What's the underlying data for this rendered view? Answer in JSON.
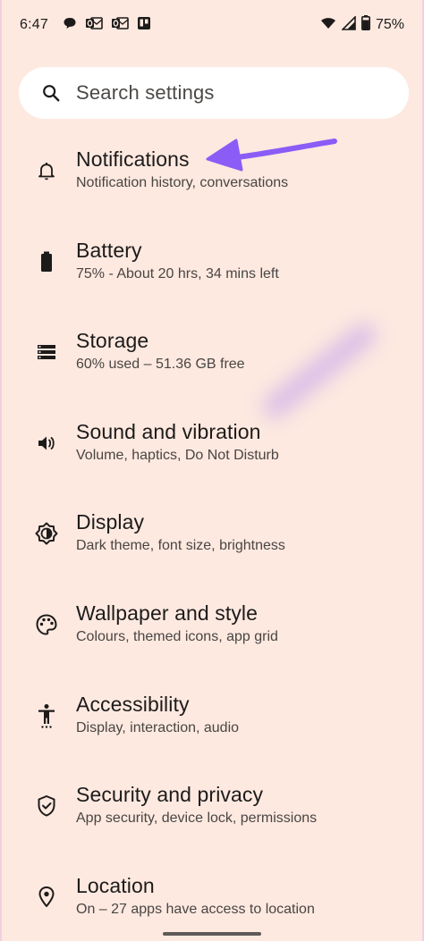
{
  "status_bar": {
    "time": "6:47",
    "battery_percent": "75%",
    "icons_left": [
      "chat-bubble-icon",
      "outlook-icon",
      "outlook-icon",
      "trello-icon"
    ],
    "icons_right": [
      "wifi-icon",
      "cellular-signal-icon",
      "battery-icon"
    ]
  },
  "search": {
    "placeholder": "Search settings"
  },
  "settings": [
    {
      "title": "Notifications",
      "subtitle": "Notification history, conversations",
      "icon": "bell-icon"
    },
    {
      "title": "Battery",
      "subtitle": "75% - About 20 hrs, 34 mins left",
      "icon": "battery-icon"
    },
    {
      "title": "Storage",
      "subtitle": "60% used – 51.36 GB free",
      "icon": "storage-icon"
    },
    {
      "title": "Sound and vibration",
      "subtitle": "Volume, haptics, Do Not Disturb",
      "icon": "volume-icon"
    },
    {
      "title": "Display",
      "subtitle": "Dark theme, font size, brightness",
      "icon": "brightness-icon"
    },
    {
      "title": "Wallpaper and style",
      "subtitle": "Colours, themed icons, app grid",
      "icon": "palette-icon"
    },
    {
      "title": "Accessibility",
      "subtitle": "Display, interaction, audio",
      "icon": "accessibility-icon"
    },
    {
      "title": "Security and privacy",
      "subtitle": "App security, device lock, permissions",
      "icon": "shield-icon"
    },
    {
      "title": "Location",
      "subtitle": "On – 27 apps have access to location",
      "icon": "location-pin-icon"
    }
  ],
  "colors": {
    "background": "#fde9e0",
    "search_background": "#ffffff",
    "annotation_arrow": "#8b5cf6",
    "text_primary": "#1d1b1a",
    "text_secondary": "#4a4543"
  }
}
